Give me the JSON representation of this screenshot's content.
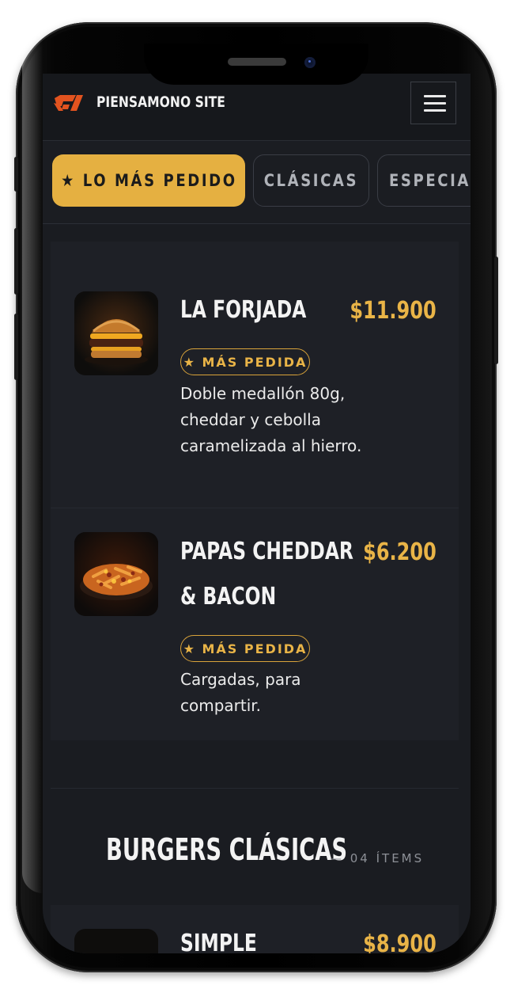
{
  "header": {
    "brand": "PIENSAMONO SITE",
    "logo_icon": "pm-logo-icon",
    "menu_icon": "hamburger-menu-icon"
  },
  "tabs": [
    {
      "label": "★ LO MÁS PEDIDO",
      "active": true
    },
    {
      "label": "CLÁSICAS",
      "active": false
    },
    {
      "label": "ESPECIAL",
      "active": false
    }
  ],
  "featured": {
    "items": [
      {
        "name": "LA FORJADA",
        "price": "$11.900",
        "badge": "★ MÁS PEDIDA",
        "description": "Doble medallón 80g, cheddar y cebolla caramelizada al hierro.",
        "image_icon": "burger-photo"
      },
      {
        "name": "PAPAS CHEDDAR & BACON",
        "price": "$6.200",
        "badge": "★ MÁS PEDIDA",
        "description": "Cargadas, para compartir.",
        "image_icon": "fries-photo"
      }
    ]
  },
  "section": {
    "title": "BURGERS CLÁSICAS",
    "count": "— 04 ÍTEMS",
    "items": [
      {
        "name": "SIMPLE",
        "price": "$8.900",
        "image_icon": "burger-photo"
      }
    ]
  },
  "colors": {
    "accent": "#e5b041",
    "background": "#1a1c21",
    "header": "#16181c",
    "logo": "#e2531f"
  }
}
